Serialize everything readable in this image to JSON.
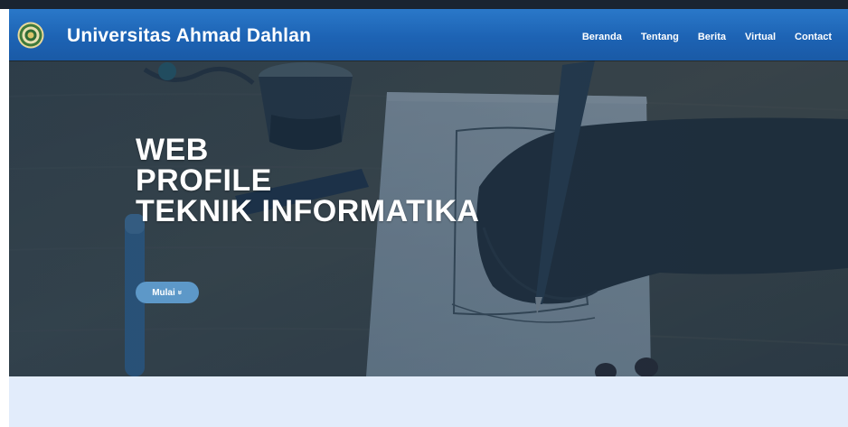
{
  "header": {
    "brand": "Universitas Ahmad Dahlan",
    "logo_icon": "university-seal-icon"
  },
  "nav": {
    "items": [
      {
        "label": "Beranda"
      },
      {
        "label": "Tentang"
      },
      {
        "label": "Berita"
      },
      {
        "label": "Virtual"
      },
      {
        "label": "Contact"
      }
    ]
  },
  "hero": {
    "title_lines": [
      "WEB",
      "PROFILE",
      "TEKNIK INFORMATIKA"
    ],
    "cta_label": "Mulai",
    "cta_icon": "double-chevron-down-icon"
  },
  "colors": {
    "navbar": "#1d63b4",
    "cta": "#5d98c8",
    "section_bg": "#e2ecfb"
  }
}
